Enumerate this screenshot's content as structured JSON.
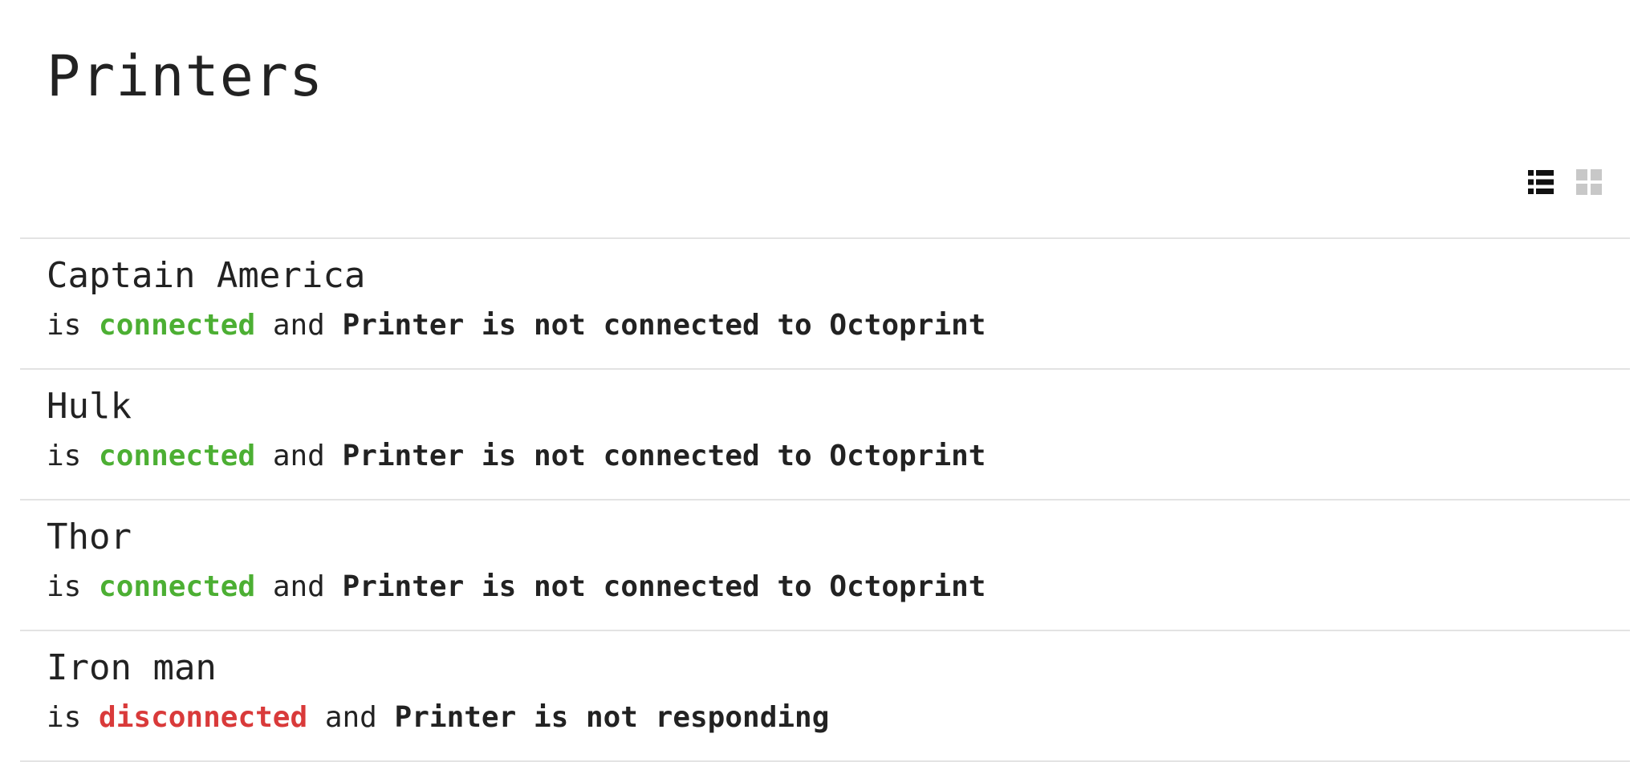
{
  "page": {
    "title": "Printers"
  },
  "view_toggle": {
    "list_icon": "list-view-icon",
    "grid_icon": "grid-view-icon",
    "active": "list",
    "active_color": "#111111",
    "inactive_color": "#c8c8c8"
  },
  "colors": {
    "connected": "#4caf33",
    "disconnected": "#d93a3a"
  },
  "printers": [
    {
      "name": "Captain America",
      "prefix": "is",
      "state": "connected",
      "conjunction": "and",
      "detail": "Printer is not connected to Octoprint"
    },
    {
      "name": "Hulk",
      "prefix": "is",
      "state": "connected",
      "conjunction": "and",
      "detail": "Printer is not connected to Octoprint"
    },
    {
      "name": "Thor",
      "prefix": "is",
      "state": "connected",
      "conjunction": "and",
      "detail": "Printer is not connected to Octoprint"
    },
    {
      "name": "Iron man",
      "prefix": "is",
      "state": "disconnected",
      "conjunction": "and",
      "detail": "Printer is not responding"
    }
  ]
}
